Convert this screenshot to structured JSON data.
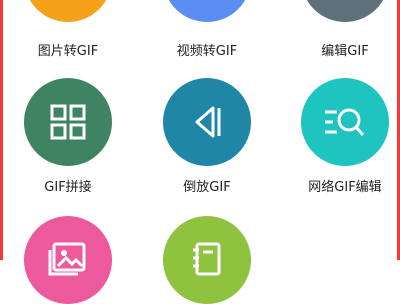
{
  "tools": [
    {
      "label": "图片转GIF",
      "icon": "image-icon",
      "color": "#f6a11a"
    },
    {
      "label": "视频转GIF",
      "icon": "video-icon",
      "color": "#5a8ef2"
    },
    {
      "label": "编辑GIF",
      "icon": "edit-icon",
      "color": "#5e7179"
    },
    {
      "label": "GIF拼接",
      "icon": "grid-icon",
      "color": "#3f8462"
    },
    {
      "label": "倒放GIF",
      "icon": "reverse-play-icon",
      "color": "#1f86a6"
    },
    {
      "label": "网络GIF编辑",
      "icon": "search-list-icon",
      "color": "#1ec4c0"
    },
    {
      "label": "",
      "icon": "photo-album-icon",
      "color": "#ec5a9d"
    },
    {
      "label": "",
      "icon": "notebook-icon",
      "color": "#8fc23f"
    }
  ],
  "colors": {
    "frame": "#ef3b3b"
  }
}
